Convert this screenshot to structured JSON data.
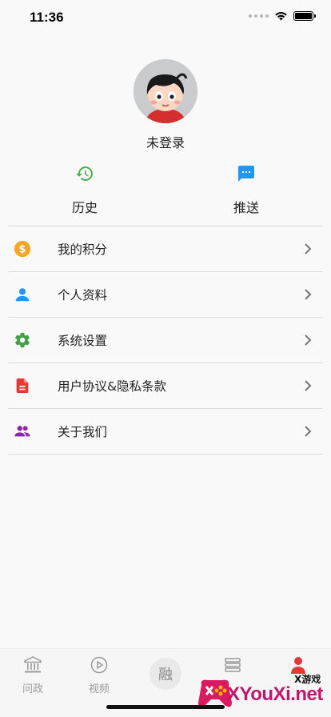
{
  "status_bar": {
    "time": "11:36"
  },
  "profile": {
    "login_status": "未登录"
  },
  "quick_actions": [
    {
      "label": "历史",
      "icon": "history-icon",
      "color": "#4caf50"
    },
    {
      "label": "推送",
      "icon": "message-icon",
      "color": "#2196f3"
    }
  ],
  "menu": [
    {
      "label": "我的积分",
      "icon": "coin-icon",
      "color": "#f5a623"
    },
    {
      "label": "个人资料",
      "icon": "person-icon",
      "color": "#2196f3"
    },
    {
      "label": "系统设置",
      "icon": "gear-icon",
      "color": "#43a047"
    },
    {
      "label": "用户协议&隐私条款",
      "icon": "document-icon",
      "color": "#e53935"
    },
    {
      "label": "关于我们",
      "icon": "group-icon",
      "color": "#8e24aa"
    }
  ],
  "tabbar": [
    {
      "label": "问政",
      "icon": "government-icon"
    },
    {
      "label": "视频",
      "icon": "play-icon"
    },
    {
      "label": "融",
      "icon": "center-badge"
    },
    {
      "label": "",
      "icon": "list-icon"
    },
    {
      "label": "",
      "icon": "person-icon",
      "color": "#e53935"
    }
  ],
  "watermark": {
    "top": "X游戏",
    "text": "XYouXi.net"
  }
}
